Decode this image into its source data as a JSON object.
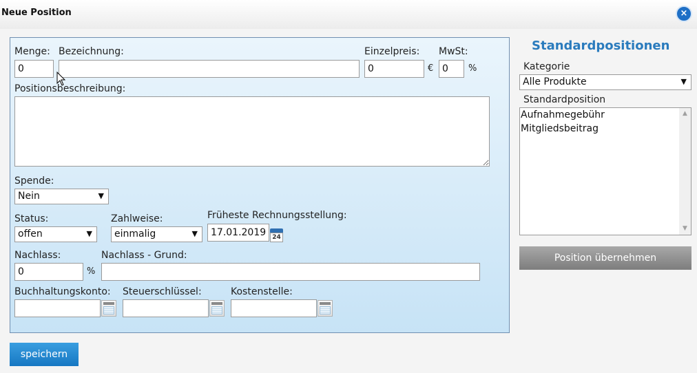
{
  "dialog": {
    "title": "Neue Position",
    "close_icon": "×"
  },
  "form": {
    "menge": {
      "label": "Menge:",
      "value": "0"
    },
    "bezeichnung": {
      "label": "Bezeichnung:",
      "value": ""
    },
    "einzelpreis": {
      "label": "Einzelpreis:",
      "value": "0",
      "unit": "€"
    },
    "mwst": {
      "label": "MwSt:",
      "value": "0",
      "unit": "%"
    },
    "positionsbeschreibung": {
      "label": "Positionsbeschreibung:",
      "value": ""
    },
    "spende": {
      "label": "Spende:",
      "selected": "Nein"
    },
    "status": {
      "label": "Status:",
      "selected": "offen"
    },
    "zahlweise": {
      "label": "Zahlweise:",
      "selected": "einmalig"
    },
    "rechnungsstellung": {
      "label": "Früheste Rechnungsstellung:",
      "value": "17.01.2019",
      "calendar_day": "24"
    },
    "nachlass": {
      "label": "Nachlass:",
      "value": "0",
      "unit": "%"
    },
    "nachlass_grund": {
      "label": "Nachlass - Grund:",
      "value": ""
    },
    "buchhaltungskonto": {
      "label": "Buchhaltungskonto:",
      "value": ""
    },
    "steuerschluessel": {
      "label": "Steuerschlüssel:",
      "value": ""
    },
    "kostenstelle": {
      "label": "Kostenstelle:",
      "value": ""
    },
    "save_label": "speichern"
  },
  "sidebar": {
    "title": "Standardpositionen",
    "kategorie": {
      "label": "Kategorie",
      "selected": "Alle Produkte"
    },
    "standardposition": {
      "label": "Standardposition",
      "items": [
        "Aufnahmegebühr",
        "Mitgliedsbeitrag"
      ]
    },
    "apply_label": "Position übernehmen"
  },
  "icons": {
    "dropdown_arrow": "▼",
    "scroll_up": "▲",
    "scroll_down": "▼"
  },
  "colors": {
    "accent_blue": "#2a7bbd",
    "save_button": "#1677c2",
    "panel_top": "#eaf5fc",
    "panel_bottom": "#c7e3f6"
  }
}
